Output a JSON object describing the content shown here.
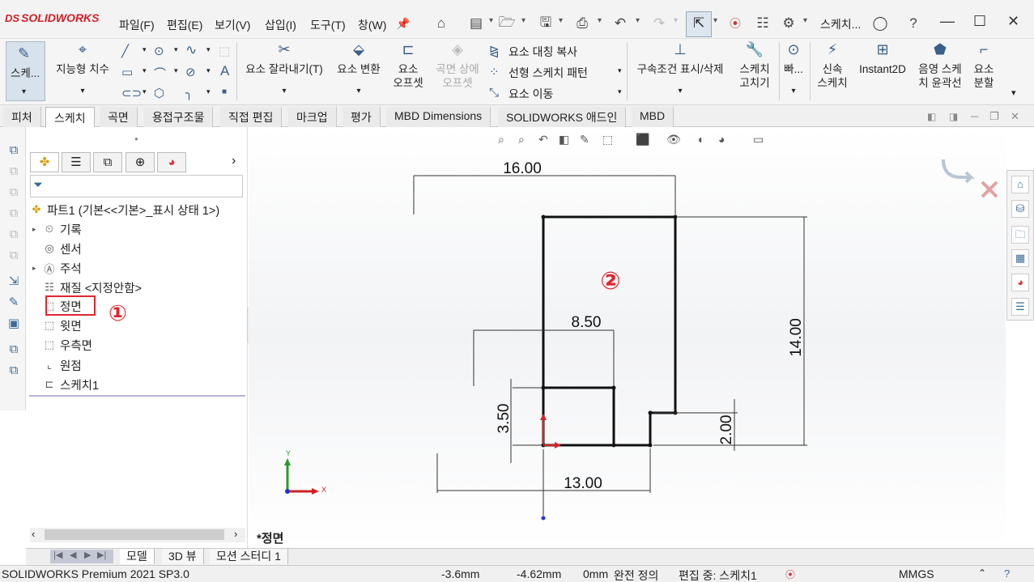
{
  "app": {
    "logo": "SOLIDWORKS",
    "logo_mark": "DS"
  },
  "menu": [
    "파일(F)",
    "편집(E)",
    "보기(V)",
    "삽입(I)",
    "도구(T)",
    "창(W)"
  ],
  "title_bar": {
    "doc_title": "스케치..."
  },
  "command_manager": {
    "sketch": "스케...",
    "smart_dim": "지능형 치수",
    "trim": "요소 잘라내기(T)",
    "convert": "요소 변환",
    "offset": "요소\n오프셋",
    "offset_l1": "요소",
    "offset_l2": "오프셋",
    "surf_offset_l1": "곡면 상에",
    "surf_offset_l2": "오프셋",
    "mirror": "요소 대칭 복사",
    "linear_pattern": "선형 스케치 패턴",
    "move": "요소 이동",
    "relations": "구속조건 표시/삭제",
    "repair_l1": "스케치",
    "repair_l2": "고치기",
    "quick": "빠...",
    "rapid_l1": "신속",
    "rapid_l2": "스케치",
    "instant2d": "Instant2D",
    "shaded_l1": "음영 스케",
    "shaded_l2": "치 윤곽선",
    "split_l1": "요소",
    "split_l2": "분할"
  },
  "tabs": [
    "피처",
    "스케치",
    "곡면",
    "용접구조물",
    "직접 편집",
    "마크업",
    "평가",
    "MBD Dimensions",
    "SOLIDWORKS 애드인",
    "MBD"
  ],
  "active_tab": "스케치",
  "tree": {
    "root": "파트1  (기본<<기본>_표시 상태 1>)",
    "items": [
      "기록",
      "센서",
      "주석",
      "재질 <지정안함>",
      "정면",
      "윗면",
      "우측면",
      "원점",
      "스케치1"
    ]
  },
  "annotations": {
    "one": "①",
    "two": "②"
  },
  "canvas": {
    "view_label": "*정면",
    "axis_x": "X",
    "axis_y": "Y"
  },
  "dimensions": {
    "d16": "16.00",
    "d14": "14.00",
    "d850": "8.50",
    "d350": "3.50",
    "d200": "2.00",
    "d1300": "13.00"
  },
  "bottom_tabs": [
    "모델",
    "3D 뷰",
    "모션 스터디 1"
  ],
  "status": {
    "product": "SOLIDWORKS Premium 2021 SP3.0",
    "x": "-3.6mm",
    "y": "-4.62mm",
    "z": "0mm",
    "defined": "완전 정의",
    "editing": "편집 중: 스케치1",
    "units": "MMGS"
  },
  "colors": {
    "accent_red": "#e0262f",
    "sketch_line": "#111111",
    "brand": "#d32027"
  }
}
